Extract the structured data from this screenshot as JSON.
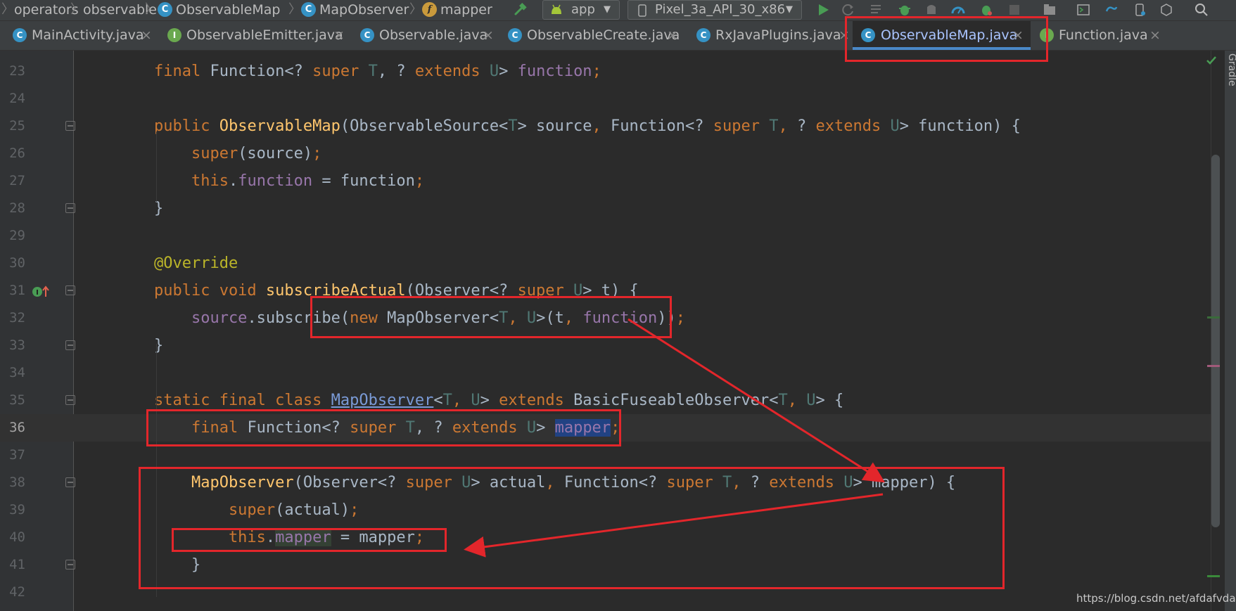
{
  "breadcrumb": {
    "items": [
      "operators",
      "observable",
      "ObservableMap",
      "MapObserver",
      "mapper"
    ]
  },
  "toolbar": {
    "run_config": "app",
    "device": "Pixel_3a_API_30_x86"
  },
  "tabs": [
    {
      "label": "MainActivity.java",
      "icon_letter": "C"
    },
    {
      "label": "ObservableEmitter.java",
      "icon_letter": "I"
    },
    {
      "label": "Observable.java",
      "icon_letter": "C"
    },
    {
      "label": "ObservableCreate.java",
      "icon_letter": "C"
    },
    {
      "label": "RxJavaPlugins.java",
      "icon_letter": "C"
    },
    {
      "label": "ObservableMap.java",
      "icon_letter": "C",
      "active": true
    },
    {
      "label": "Function.java",
      "icon_letter": "I"
    }
  ],
  "tab_close_glyph": "×",
  "side_panel": {
    "gradle_label": "Gradle"
  },
  "editor": {
    "current_line": 36,
    "lines": [
      {
        "n": "23",
        "t": [
          [
            "    final ",
            "k"
          ],
          [
            "Function<? ",
            ""
          ],
          [
            "super ",
            "k"
          ],
          [
            "T",
            "tp"
          ],
          [
            ", ? ",
            ""
          ],
          [
            "extends ",
            "k"
          ],
          [
            "U",
            "tp"
          ],
          [
            "> ",
            ""
          ],
          [
            "function",
            "fld"
          ],
          [
            ";",
            "k"
          ]
        ]
      },
      {
        "n": "24",
        "t": []
      },
      {
        "n": "25",
        "t": [
          [
            "    public ",
            "k"
          ],
          [
            "ObservableMap",
            "fn"
          ],
          [
            "(ObservableSource<",
            ""
          ],
          [
            "T",
            "tp"
          ],
          [
            "> source",
            ""
          ],
          [
            ", ",
            "k"
          ],
          [
            "Function<? ",
            ""
          ],
          [
            "super ",
            "k"
          ],
          [
            "T",
            "tp"
          ],
          [
            ", ",
            "k"
          ],
          [
            "? ",
            ""
          ],
          [
            "extends ",
            "k"
          ],
          [
            "U",
            "tp"
          ],
          [
            "> function) {",
            ""
          ]
        ]
      },
      {
        "n": "26",
        "t": [
          [
            "        super",
            "k"
          ],
          [
            "(source)",
            ""
          ],
          [
            ";",
            "k"
          ]
        ]
      },
      {
        "n": "27",
        "t": [
          [
            "        this",
            "k"
          ],
          [
            ".",
            ""
          ],
          [
            "function",
            "fld"
          ],
          [
            " = function",
            ""
          ],
          [
            ";",
            "k"
          ]
        ]
      },
      {
        "n": "28",
        "t": [
          [
            "    }",
            ""
          ]
        ]
      },
      {
        "n": "29",
        "t": []
      },
      {
        "n": "30",
        "t": [
          [
            "    @Override",
            "ann"
          ]
        ]
      },
      {
        "n": "31",
        "t": [
          [
            "    public void ",
            "k"
          ],
          [
            "subscribeActual",
            "fn"
          ],
          [
            "(Observer<? ",
            ""
          ],
          [
            "super ",
            "k"
          ],
          [
            "U",
            "tp"
          ],
          [
            "> t) {",
            ""
          ]
        ]
      },
      {
        "n": "32",
        "t": [
          [
            "        source",
            "fld"
          ],
          [
            ".subscribe(",
            ""
          ],
          [
            "new ",
            "k"
          ],
          [
            "MapObserver<",
            ""
          ],
          [
            "T",
            "tp"
          ],
          [
            ", ",
            "k"
          ],
          [
            "U",
            "tp"
          ],
          [
            ">(t",
            ""
          ],
          [
            ", ",
            "k"
          ],
          [
            "function",
            "fld"
          ],
          [
            "))",
            ""
          ],
          [
            ";",
            "k"
          ]
        ]
      },
      {
        "n": "33",
        "t": [
          [
            "    }",
            ""
          ]
        ]
      },
      {
        "n": "34",
        "t": []
      },
      {
        "n": "35",
        "t": [
          [
            "    static final class ",
            "k"
          ],
          [
            "MapObserver",
            "lnk"
          ],
          [
            "<",
            ""
          ],
          [
            "T",
            "tp"
          ],
          [
            ", ",
            "k"
          ],
          [
            "U",
            "tp"
          ],
          [
            "> ",
            ""
          ],
          [
            "extends ",
            "k"
          ],
          [
            "BasicFuseableObserver<",
            ""
          ],
          [
            "T",
            "tp"
          ],
          [
            ", ",
            "k"
          ],
          [
            "U",
            "tp"
          ],
          [
            "> {",
            ""
          ]
        ]
      },
      {
        "n": "36",
        "t": [
          [
            "        final ",
            "k"
          ],
          [
            "Function<? ",
            ""
          ],
          [
            "super ",
            "k"
          ],
          [
            "T",
            "tp"
          ],
          [
            ", ? ",
            ""
          ],
          [
            "extends ",
            "k"
          ],
          [
            "U",
            "tp"
          ],
          [
            "> ",
            ""
          ],
          [
            "mapper",
            "fld sel"
          ],
          [
            ";",
            "k"
          ]
        ]
      },
      {
        "n": "37",
        "t": []
      },
      {
        "n": "38",
        "t": [
          [
            "        ",
            ""
          ],
          [
            "MapObserver",
            "fn"
          ],
          [
            "(Observer<? ",
            ""
          ],
          [
            "super ",
            "k"
          ],
          [
            "U",
            "tp"
          ],
          [
            "> actual",
            ""
          ],
          [
            ", ",
            "k"
          ],
          [
            "Function<? ",
            ""
          ],
          [
            "super ",
            "k"
          ],
          [
            "T",
            "tp"
          ],
          [
            ", ",
            "k"
          ],
          [
            "? ",
            ""
          ],
          [
            "extends ",
            "k"
          ],
          [
            "U",
            "tp"
          ],
          [
            "> mapper) {",
            ""
          ]
        ]
      },
      {
        "n": "39",
        "t": [
          [
            "            super",
            "k"
          ],
          [
            "(actual)",
            ""
          ],
          [
            ";",
            "k"
          ]
        ]
      },
      {
        "n": "40",
        "t": [
          [
            "            this",
            "k"
          ],
          [
            ".",
            ""
          ],
          [
            "mapper",
            "fld hl"
          ],
          [
            " = mapper",
            ""
          ],
          [
            ";",
            "k"
          ]
        ]
      },
      {
        "n": "41",
        "t": [
          [
            "        }",
            ""
          ]
        ]
      },
      {
        "n": "42",
        "t": []
      }
    ]
  },
  "watermark": "https://blog.csdn.net/afdafvdaa"
}
